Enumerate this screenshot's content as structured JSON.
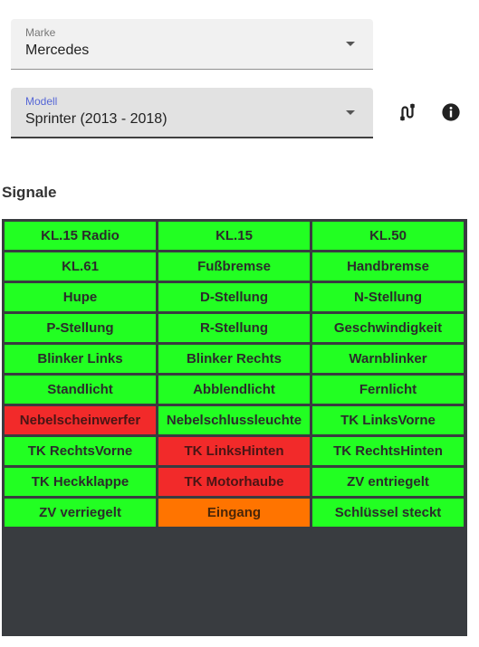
{
  "marke": {
    "label": "Marke",
    "value": "Mercedes"
  },
  "modell": {
    "label": "Modell",
    "value": "Sprinter (2013 - 2018)"
  },
  "icons": {
    "signal": "signal-plug-icon",
    "info": "info-icon"
  },
  "signale": {
    "title": "Signale",
    "colors": {
      "active": "#22ff22",
      "error": "#f22a2a",
      "input": "#ff7400",
      "panel": "#393c40"
    },
    "cells": [
      {
        "label": "KL.15 Radio",
        "status": "green"
      },
      {
        "label": "KL.15",
        "status": "green"
      },
      {
        "label": "KL.50",
        "status": "green"
      },
      {
        "label": "KL.61",
        "status": "green"
      },
      {
        "label": "Fußbremse",
        "status": "green"
      },
      {
        "label": "Handbremse",
        "status": "green"
      },
      {
        "label": "Hupe",
        "status": "green"
      },
      {
        "label": "D-Stellung",
        "status": "green"
      },
      {
        "label": "N-Stellung",
        "status": "green"
      },
      {
        "label": "P-Stellung",
        "status": "green"
      },
      {
        "label": "R-Stellung",
        "status": "green"
      },
      {
        "label": "Geschwindigkeit",
        "status": "green"
      },
      {
        "label": "Blinker Links",
        "status": "green"
      },
      {
        "label": "Blinker Rechts",
        "status": "green"
      },
      {
        "label": "Warnblinker",
        "status": "green"
      },
      {
        "label": "Standlicht",
        "status": "green"
      },
      {
        "label": "Abblendlicht",
        "status": "green"
      },
      {
        "label": "Fernlicht",
        "status": "green"
      },
      {
        "label": "Nebelscheinwerfer",
        "status": "red"
      },
      {
        "label": "Nebelschlussleuchte",
        "status": "green"
      },
      {
        "label": "TK LinksVorne",
        "status": "green"
      },
      {
        "label": "TK RechtsVorne",
        "status": "green"
      },
      {
        "label": "TK LinksHinten",
        "status": "red"
      },
      {
        "label": "TK RechtsHinten",
        "status": "green"
      },
      {
        "label": "TK Heckklappe",
        "status": "green"
      },
      {
        "label": "TK Motorhaube",
        "status": "red"
      },
      {
        "label": "ZV entriegelt",
        "status": "green"
      },
      {
        "label": "ZV verriegelt",
        "status": "green"
      },
      {
        "label": "Eingang",
        "status": "orange"
      },
      {
        "label": "Schlüssel steckt",
        "status": "green"
      }
    ]
  }
}
